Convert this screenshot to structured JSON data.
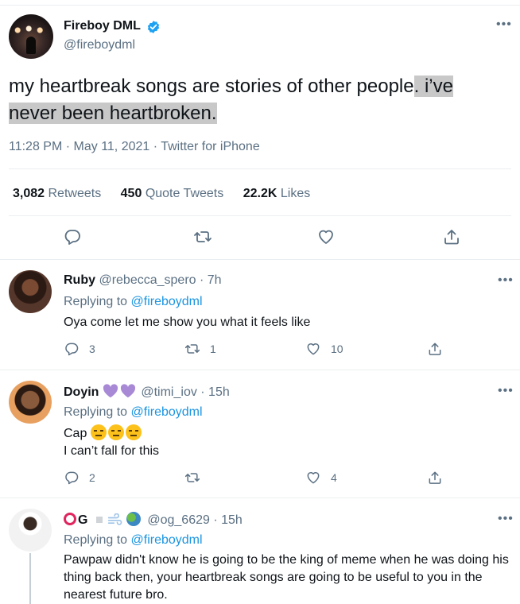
{
  "tweet": {
    "author_name": "Fireboy DML",
    "author_handle": "@fireboydml",
    "text_plain": "my heartbreak songs are stories of other people",
    "text_highlighted_a": ". i’ve",
    "text_highlighted_b": "never been heartbroken.",
    "meta": "11:28 PM · May 11, 2021 · Twitter for iPhone",
    "stats": {
      "retweets_count": "3,082",
      "retweets_label": "Retweets",
      "quotes_count": "450",
      "quotes_label": "Quote Tweets",
      "likes_count": "22.2K",
      "likes_label": "Likes"
    },
    "more": "•••"
  },
  "replies": [
    {
      "name": "Ruby",
      "handle_time": "@rebecca_spero · 7h",
      "replying_label": "Replying to",
      "replying_to": "@fireboydml",
      "text": "Oya come let me show you what it feels like",
      "reply_count": "3",
      "retweet_count": "1",
      "like_count": "10",
      "more": "•••"
    },
    {
      "name": "Doyin",
      "handle_time": "@timi_iov · 15h",
      "replying_label": "Replying to",
      "replying_to": "@fireboydml",
      "text_line1": "Cap",
      "text_line2": "I can’t fall for this",
      "reply_count": "2",
      "retweet_count": "",
      "like_count": "4",
      "more": "•••"
    },
    {
      "name": "G",
      "handle_time": "@og_6629 · 15h",
      "replying_label": "Replying to",
      "replying_to": "@fireboydml",
      "text": "Pawpaw didn't know he is going to be the king of meme when he was doing his thing back then, your heartbreak songs are going to be useful to you in the nearest future bro.",
      "more": "•••"
    }
  ],
  "colors": {
    "accent": "#1da1f2",
    "mention": "#1b95e0",
    "secondary_text": "#5b7083",
    "highlight": "#c8c8c8",
    "heart_purple": "#a889d6"
  },
  "icons": [
    "verified-icon",
    "reply-icon",
    "retweet-icon",
    "like-icon",
    "share-icon",
    "more-icon"
  ]
}
